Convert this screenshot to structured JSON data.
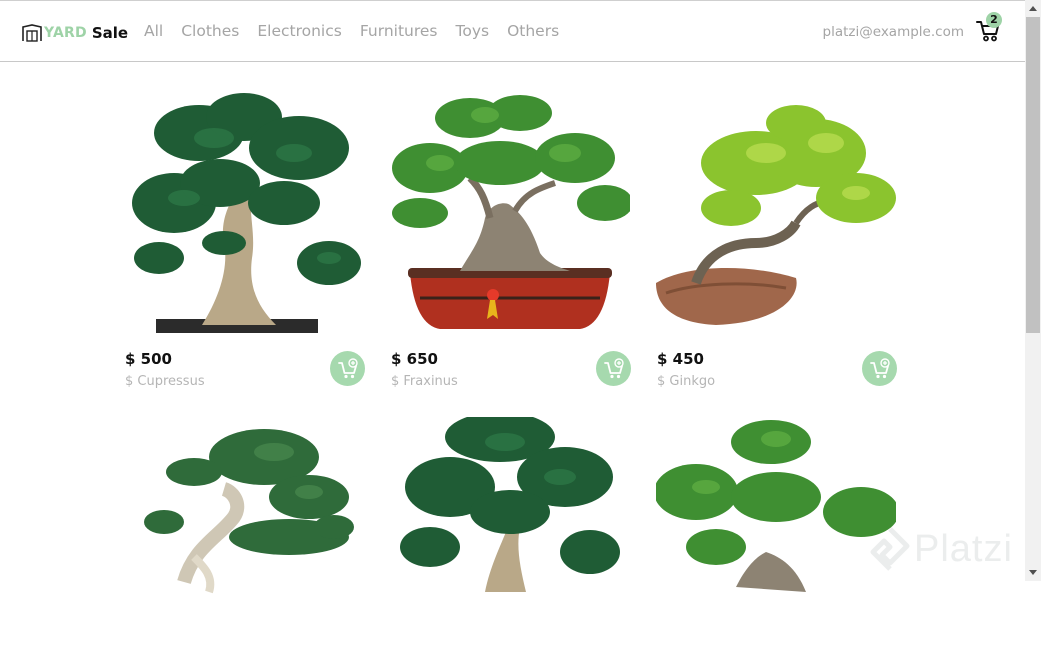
{
  "brand": {
    "yard": "YARD",
    "sale": "Sale"
  },
  "nav": {
    "links": [
      "All",
      "Clothes",
      "Electronics",
      "Furnitures",
      "Toys",
      "Others"
    ]
  },
  "user": {
    "email": "platzi@example.com"
  },
  "cart": {
    "count": "2",
    "icon": "shopping-cart-icon"
  },
  "colors": {
    "accent": "#9ed3a7",
    "button": "#a6d9ae",
    "muted_text": "#a5a5a5"
  },
  "products": [
    {
      "price": "$ 500",
      "name": "$ Cupressus"
    },
    {
      "price": "$ 650",
      "name": "$ Fraxinus"
    },
    {
      "price": "$ 450",
      "name": "$ Ginkgo"
    },
    {
      "price": "",
      "name": ""
    },
    {
      "price": "",
      "name": ""
    },
    {
      "price": "",
      "name": ""
    }
  ],
  "watermark": {
    "text": "Platzi"
  }
}
